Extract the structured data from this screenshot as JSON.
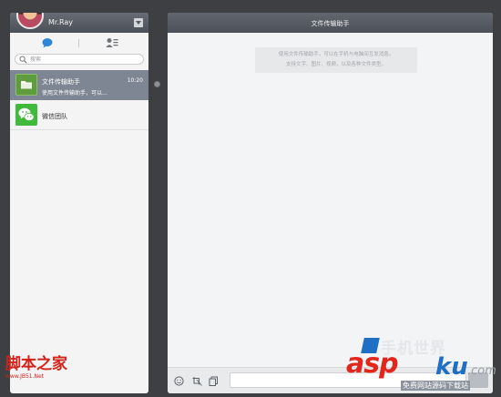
{
  "user": {
    "name": "Mr.Ray"
  },
  "search": {
    "placeholder": "搜索"
  },
  "conversations": [
    {
      "name": "文件传输助手",
      "preview": "使用文件传输助手，可以…",
      "time": "10:20",
      "icon": "folder-icon",
      "selected": true
    },
    {
      "name": "微信团队",
      "icon": "wechat-logo-icon",
      "selected": false
    }
  ],
  "chat": {
    "title": "文件传输助手",
    "notice_line1": "使用文件传输助手，可以在手机与电脑间互发消息。",
    "notice_line2": "支持文字、图片、视频，以及各种文件类型。"
  },
  "composer": {
    "tools": [
      "emoji-icon",
      "screenshot-icon",
      "file-icon"
    ]
  },
  "watermarks": {
    "jb51_title": "脚本之家",
    "jb51_url": "www.JB51.Net",
    "asp_brand": "手机世界",
    "asp_logo": "asp",
    "asp_ku": "ku",
    "asp_com": ".com",
    "asp_sub": "免费网站源码下载站"
  },
  "colors": {
    "background": "#3d3f43",
    "header": "#555a62",
    "selected_row": "#7f8693",
    "panel": "#f4f4f5",
    "watermark_red": "#d3231a",
    "watermark_blue": "#1f6fc4"
  }
}
